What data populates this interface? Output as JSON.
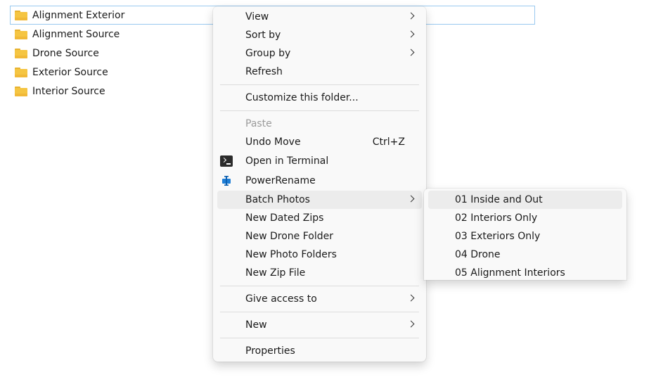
{
  "files": [
    {
      "name": "Alignment Exterior",
      "selected": true
    },
    {
      "name": "Alignment Source",
      "selected": false
    },
    {
      "name": "Drone Source",
      "selected": false
    },
    {
      "name": "Exterior Source",
      "selected": false
    },
    {
      "name": "Interior Source",
      "selected": false
    }
  ],
  "menu": {
    "view": "View",
    "sort_by": "Sort by",
    "group_by": "Group by",
    "refresh": "Refresh",
    "customize": "Customize this folder...",
    "paste": "Paste",
    "undo_move": "Undo Move",
    "undo_shortcut": "Ctrl+Z",
    "open_terminal": "Open in Terminal",
    "power_rename": "PowerRename",
    "batch_photos": "Batch Photos",
    "new_dated_zips": "New Dated Zips",
    "new_drone_folder": "New Drone Folder",
    "new_photo_folders": "New Photo Folders",
    "new_zip_file": "New Zip File",
    "give_access": "Give access to",
    "new": "New",
    "properties": "Properties"
  },
  "submenu": {
    "items": [
      "01 Inside and Out",
      "02 Interiors Only",
      "03 Exteriors Only",
      "04 Drone",
      "05 Alignment Interiors"
    ]
  },
  "icons": {
    "folder": "folder-icon",
    "terminal": "terminal-icon",
    "powerrename": "powerrename-icon",
    "chevron": "chevron-right-icon"
  },
  "colors": {
    "selection_border": "#99c9ef",
    "menu_bg": "#f9f9f9",
    "hover_bg": "#ececec",
    "folder": "#f5c542",
    "powerrename_blue": "#1f7ed6"
  }
}
